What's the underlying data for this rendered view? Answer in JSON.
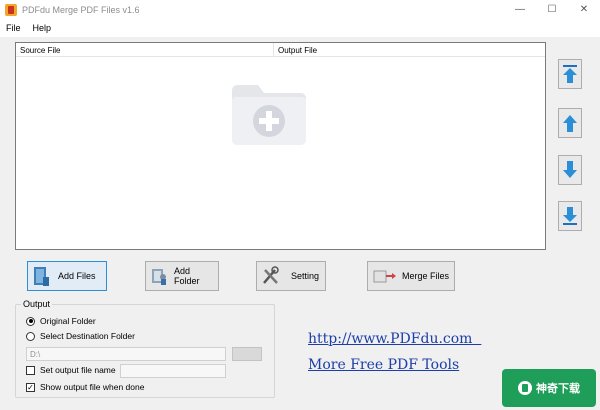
{
  "window": {
    "title": "PDFdu Merge PDF Files v1.6",
    "minimize_glyph": "—",
    "maximize_glyph": "☐",
    "close_glyph": "✕"
  },
  "menu": {
    "items": [
      "File",
      "Help"
    ]
  },
  "table": {
    "columns": [
      "Source File",
      "Output File"
    ],
    "rows": [],
    "empty_icon": "add-folder-icon"
  },
  "move_buttons": [
    {
      "name": "move-to-top-button",
      "icon": "arrow-top-icon"
    },
    {
      "name": "move-up-button",
      "icon": "arrow-up-icon"
    },
    {
      "name": "move-down-button",
      "icon": "arrow-down-icon"
    },
    {
      "name": "move-to-bottom-button",
      "icon": "arrow-bottom-icon"
    }
  ],
  "actions": {
    "add_files": "Add Files",
    "add_folder": "Add Folder",
    "setting": "Setting",
    "merge_files": "Merge Files"
  },
  "output": {
    "group_title": "Output",
    "original_folder": "Original Folder",
    "select_destination": "Select Destination Folder",
    "selected": "original_folder",
    "path_value": "D:\\",
    "set_output_name_label": "Set output file name",
    "set_output_name_checked": false,
    "output_name_value": "",
    "show_output_label": "Show output file when done",
    "show_output_checked": true
  },
  "links": {
    "website": "http://www.PDFdu.com  ",
    "more_tools": "More Free PDF Tools"
  },
  "watermark": {
    "text": "神奇下载"
  },
  "colors": {
    "accent_blue": "#2a8fd6",
    "link_blue": "#1b3ea8",
    "watermark_green": "#1e9e58"
  }
}
